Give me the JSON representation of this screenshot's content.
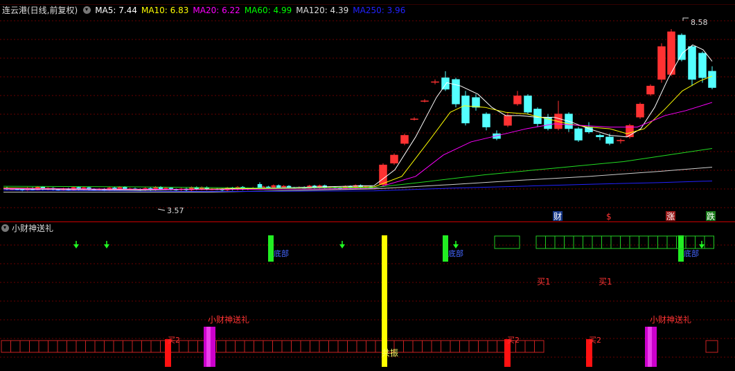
{
  "header": {
    "title": "连云港(日线,前复权)",
    "ma": [
      {
        "label": "MA5: 7.44",
        "color": "#ffffff"
      },
      {
        "label": "MA10: 6.83",
        "color": "#ffff00"
      },
      {
        "label": "MA20: 6.22",
        "color": "#ff00ff"
      },
      {
        "label": "MA60: 4.99",
        "color": "#00ff00"
      },
      {
        "label": "MA120: 4.39",
        "color": "#dddddd"
      },
      {
        "label": "MA250: 3.96",
        "color": "#2222ff"
      }
    ]
  },
  "main": {
    "high_label": "8.58",
    "low_label": "3.57",
    "event_markers": [
      {
        "text": "财",
        "color": "#ffffff",
        "bg": "#1a3a8a"
      },
      {
        "text": "$",
        "color": "#ff3333",
        "bg": ""
      },
      {
        "text": "涨",
        "color": "#ffffff",
        "bg": "#9a1a1a"
      },
      {
        "text": "跌",
        "color": "#ffffff",
        "bg": "#1a7a1a"
      }
    ]
  },
  "indicator": {
    "title": "小财神送礼",
    "labels": {
      "buy1": "买1",
      "buy2": "买2",
      "gift": "小财神送礼",
      "resonance": "共振",
      "bottom": "底部"
    }
  }
}
